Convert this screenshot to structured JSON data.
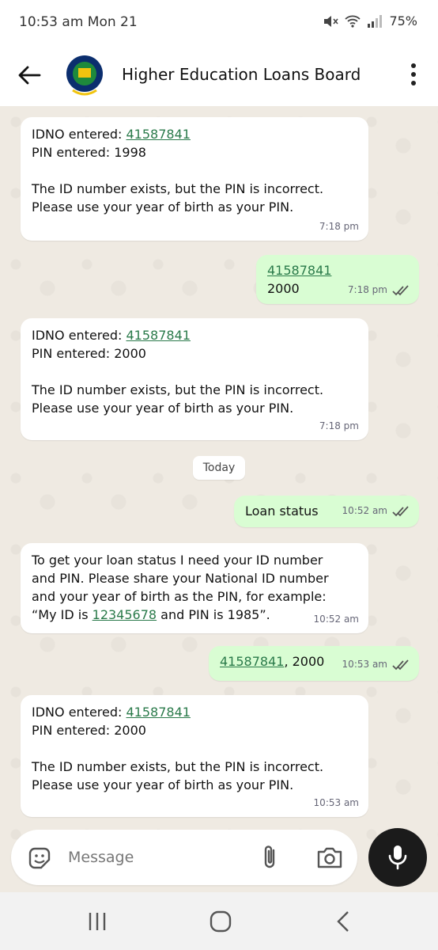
{
  "status_bar": {
    "time": "10:53 am  Mon 21",
    "battery": "75%"
  },
  "header": {
    "title": "Higher Education Loans Board"
  },
  "messages": [
    {
      "dir": "in",
      "lines": [
        "IDNO entered: ",
        "PIN entered: 1998",
        "",
        "The ID number exists, but the PIN is incorrect.",
        "Please use your year of birth as your PIN."
      ],
      "link": "41587841",
      "time": "7:18 pm"
    },
    {
      "dir": "out",
      "link": "41587841",
      "text": "2000",
      "time": "7:18 pm"
    },
    {
      "dir": "in",
      "lines": [
        "IDNO entered: ",
        "PIN entered: 2000",
        "",
        "The ID number exists, but the PIN is incorrect.",
        "Please use your year of birth as your PIN."
      ],
      "link": "41587841",
      "time": "7:18 pm"
    },
    {
      "dir": "out",
      "text": "Loan status",
      "time": "10:52 am"
    },
    {
      "dir": "in",
      "lines": [
        "To get your loan status I need your ID number",
        "and PIN. Please share your National ID number",
        "and your year of birth as the PIN, for example:",
        "“My ID is ",
        " and PIN is 1985”."
      ],
      "link": "12345678",
      "time": "10:52 am"
    },
    {
      "dir": "out",
      "link": "41587841",
      "text": ", 2000",
      "time": "10:53 am"
    },
    {
      "dir": "in",
      "lines": [
        "IDNO entered: ",
        "PIN entered: 2000",
        "",
        "The ID number exists, but the PIN is incorrect.",
        "Please use your year of birth as your PIN."
      ],
      "link": "41587841",
      "time": "10:53 am"
    }
  ],
  "date_chip": "Today",
  "composer": {
    "placeholder": "Message"
  },
  "colors": {
    "outgoing": "#d9fdd3",
    "incoming": "#ffffff",
    "link": "#2a7a4a",
    "ticks": "#53bdeb"
  },
  "icons": [
    "back-arrow-icon",
    "menu-kebab-icon",
    "emoji-sticker-icon",
    "attach-icon",
    "camera-icon",
    "mic-icon",
    "recents-icon",
    "home-icon",
    "back-nav-icon"
  ]
}
